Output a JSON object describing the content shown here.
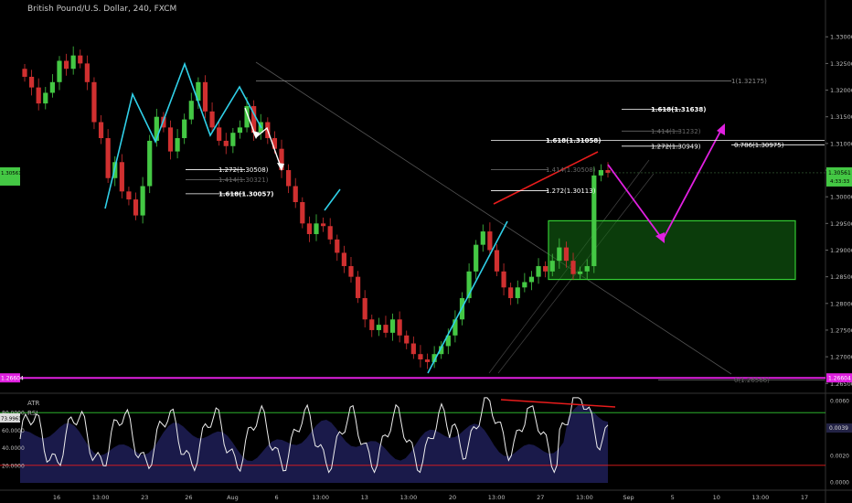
{
  "header": {
    "title": "British Pound/U.S. Dollar, 240, FXCM"
  },
  "colors": {
    "up": "#44c844",
    "down": "#d03030",
    "cyan": "#30d0e8",
    "magenta": "#e020e0",
    "red": "#e81c1c",
    "green": "#33cc33",
    "rsi_fill": "#1a1a4a"
  },
  "chart_data": [
    {
      "type": "candlestick",
      "title": "British Pound/U.S. Dollar, 240, FXCM",
      "price_axis": {
        "ylim": [
          1.2635,
          1.3345
        ],
        "ticks": [
          "1.33000",
          "1.32500",
          "1.32000",
          "1.31500",
          "1.31000",
          "1.30500",
          "1.30000",
          "1.29500",
          "1.29000",
          "1.28500",
          "1.28000",
          "1.27500",
          "1.27000",
          "1.26500"
        ]
      },
      "time_axis": {
        "ticks": [
          "16",
          "13:00",
          "23",
          "26",
          "Aug",
          "6",
          "13:00",
          "13",
          "13:00",
          "20",
          "13:00",
          "27",
          "13:00",
          "Sep",
          "5",
          "10",
          "13:00",
          "17"
        ]
      },
      "current_price_label": "1.30561",
      "current_price_sub": "4:33:33",
      "support_level": 1.26604,
      "support_label": "1.26604",
      "support_label_right": "1.26604",
      "price_path": [
        1.3225,
        1.3205,
        1.3175,
        1.3195,
        1.3215,
        1.3255,
        1.324,
        1.3265,
        1.325,
        1.3215,
        1.314,
        1.311,
        1.3035,
        1.3065,
        1.301,
        1.2995,
        1.2965,
        1.302,
        1.3105,
        1.315,
        1.313,
        1.3085,
        1.311,
        1.3145,
        1.318,
        1.3215,
        1.316,
        1.313,
        1.3105,
        1.3095,
        1.312,
        1.313,
        1.317,
        1.312,
        1.314,
        1.311,
        1.309,
        1.305,
        1.302,
        1.299,
        1.295,
        1.293,
        1.295,
        1.2945,
        1.292,
        1.2895,
        1.287,
        1.285,
        1.281,
        1.277,
        1.275,
        1.276,
        1.2745,
        1.277,
        1.274,
        1.2725,
        1.2705,
        1.2695,
        1.269,
        1.2705,
        1.272,
        1.274,
        1.277,
        1.281,
        1.286,
        1.291,
        1.2935,
        1.29,
        1.286,
        1.283,
        1.281,
        1.283,
        1.284,
        1.285,
        1.287,
        1.286,
        1.288,
        1.2905,
        1.288,
        1.2855,
        1.286,
        1.287,
        1.304,
        1.305,
        1.3045
      ],
      "fib_levels": [
        {
          "text": "1(1.32175)",
          "value": 1.32175
        },
        {
          "text": "1.618(1.31638)",
          "value": 1.31638
        },
        {
          "text": "1.414(1.31232)",
          "value": 1.31232
        },
        {
          "text": "1.618(1.31058)",
          "value": 1.31058
        },
        {
          "text": "1.272(1.30949)",
          "value": 1.30949
        },
        {
          "text": "0.786(1.30975)",
          "value": 1.30975
        },
        {
          "text": "1.414(1.30508)",
          "value": 1.30508
        },
        {
          "text": "1.272(1.30508)",
          "value": 1.30508
        },
        {
          "text": "1.414(1.30321)",
          "value": 1.30321
        },
        {
          "text": "1.272(1.30113)",
          "value": 1.30113
        },
        {
          "text": "1.618(1.30057)",
          "value": 1.30057
        },
        {
          "text": "0(1.26566)",
          "value": 1.26566
        }
      ],
      "zone": {
        "from": 1.2845,
        "to": 1.2955
      }
    },
    {
      "type": "line",
      "indicator_labels": [
        "ATR",
        "RSI"
      ],
      "rsi_value_label": "73.9961",
      "rsi_levels": [
        80,
        20
      ],
      "left_ticks": [
        "80.0000",
        "60.0000",
        "40.0000",
        "20.0000"
      ],
      "right_ticks": [
        "0.0060",
        "0.0039",
        "0.0020",
        "0.0000"
      ],
      "atr_value_label": "0.0039",
      "ylim": [
        0,
        100
      ]
    }
  ]
}
